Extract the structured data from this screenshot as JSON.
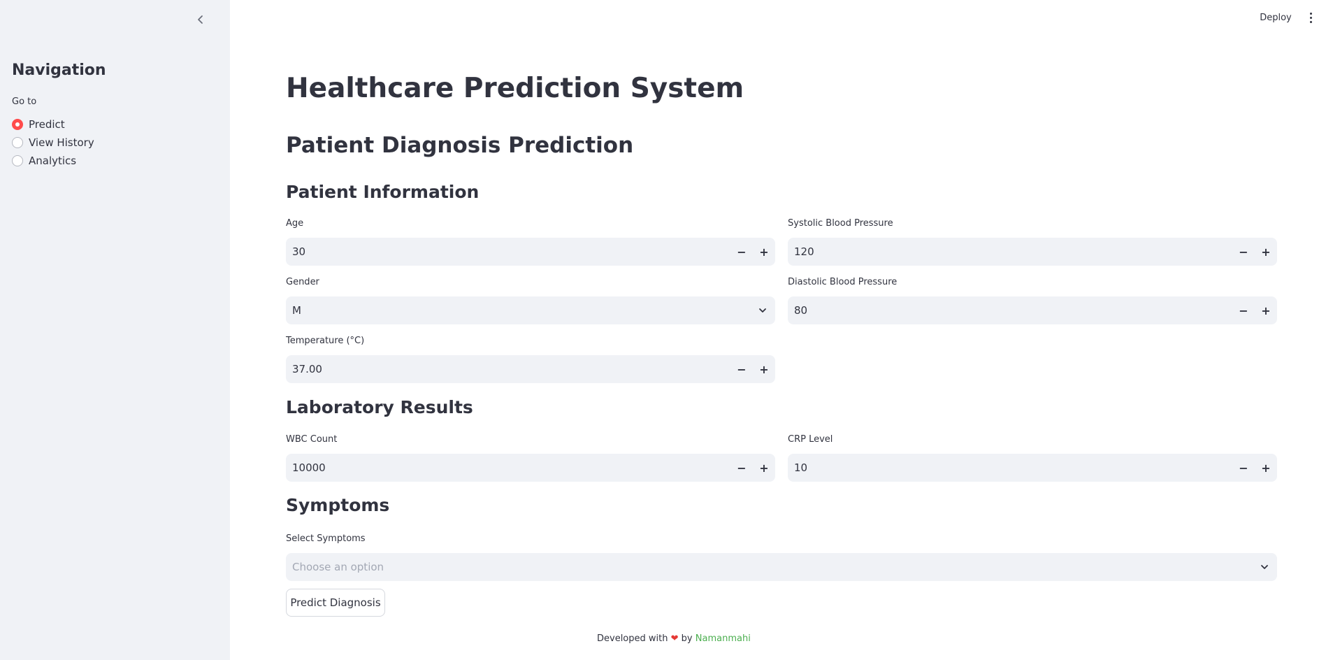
{
  "sidebar": {
    "title": "Navigation",
    "radio_label": "Go to",
    "options": [
      "Predict",
      "View History",
      "Analytics"
    ],
    "selected": "Predict"
  },
  "header": {
    "deploy_label": "Deploy"
  },
  "main": {
    "title": "Healthcare Prediction System",
    "subtitle": "Patient Diagnosis Prediction",
    "patient_info": {
      "heading": "Patient Information",
      "age": {
        "label": "Age",
        "value": "30"
      },
      "gender": {
        "label": "Gender",
        "value": "M"
      },
      "temperature": {
        "label": "Temperature (°C)",
        "value": "37.00"
      },
      "systolic": {
        "label": "Systolic Blood Pressure",
        "value": "120"
      },
      "diastolic": {
        "label": "Diastolic Blood Pressure",
        "value": "80"
      }
    },
    "lab_results": {
      "heading": "Laboratory Results",
      "wbc": {
        "label": "WBC Count",
        "value": "10000"
      },
      "crp": {
        "label": "CRP Level",
        "value": "10"
      }
    },
    "symptoms": {
      "heading": "Symptoms",
      "label": "Select Symptoms",
      "placeholder": "Choose an option"
    },
    "predict_button": "Predict Diagnosis"
  },
  "footer": {
    "prefix": "Developed with",
    "by": "by",
    "author": "Namanmahi"
  },
  "icons": {
    "collapse": "chevron-left-icon",
    "menu": "kebab-menu-icon",
    "dropdown": "chevron-down-icon",
    "heart": "heart-icon"
  },
  "colors": {
    "accent": "#ff4b4b",
    "sidebar_bg": "#f0f2f6",
    "link": "#4caf50",
    "heart": "#e53935"
  }
}
